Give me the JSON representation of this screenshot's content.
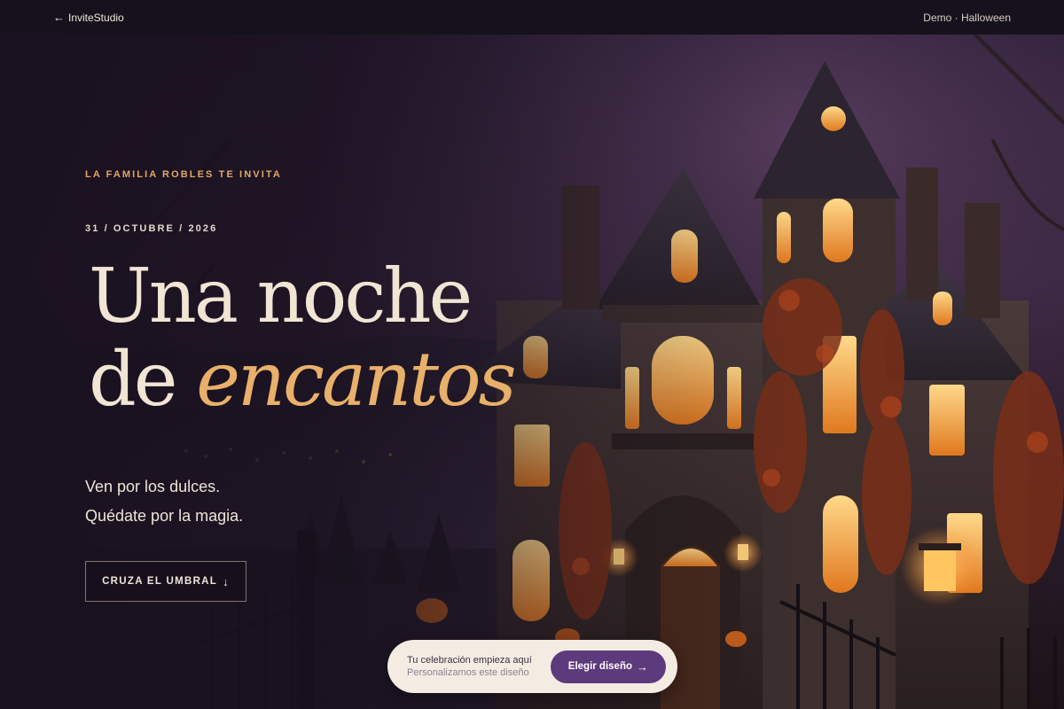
{
  "topbar": {
    "brand_link": "InviteStudio",
    "demo_label": "Demo · Halloween"
  },
  "hero": {
    "eyebrow": "LA FAMILIA ROBLES TE INVITA",
    "date": "31 / OCTUBRE / 2026",
    "headline_line1": "Una noche",
    "headline_line2_plain": "de ",
    "headline_line2_accent": "encantos",
    "tagline_line1": "Ven por los dulces.",
    "tagline_line2": "Quédate por la magia.",
    "cta_label": "CRUZA EL UMBRAL"
  },
  "promo": {
    "title": "Tu celebración empieza aquí",
    "subtitle": "Personalizamos este diseño",
    "button_label": "Elegir diseño"
  },
  "icons": {
    "back": "arrow-left-icon",
    "cta": "arrow-down-icon",
    "promo": "arrow-right-icon"
  },
  "colors": {
    "accent_gold": "#e8b06a",
    "eyebrow_orange": "#e2a866",
    "button_purple": "#5d3a7b",
    "topbar_bg": "#16121d",
    "promo_bg": "#f4ece3"
  }
}
